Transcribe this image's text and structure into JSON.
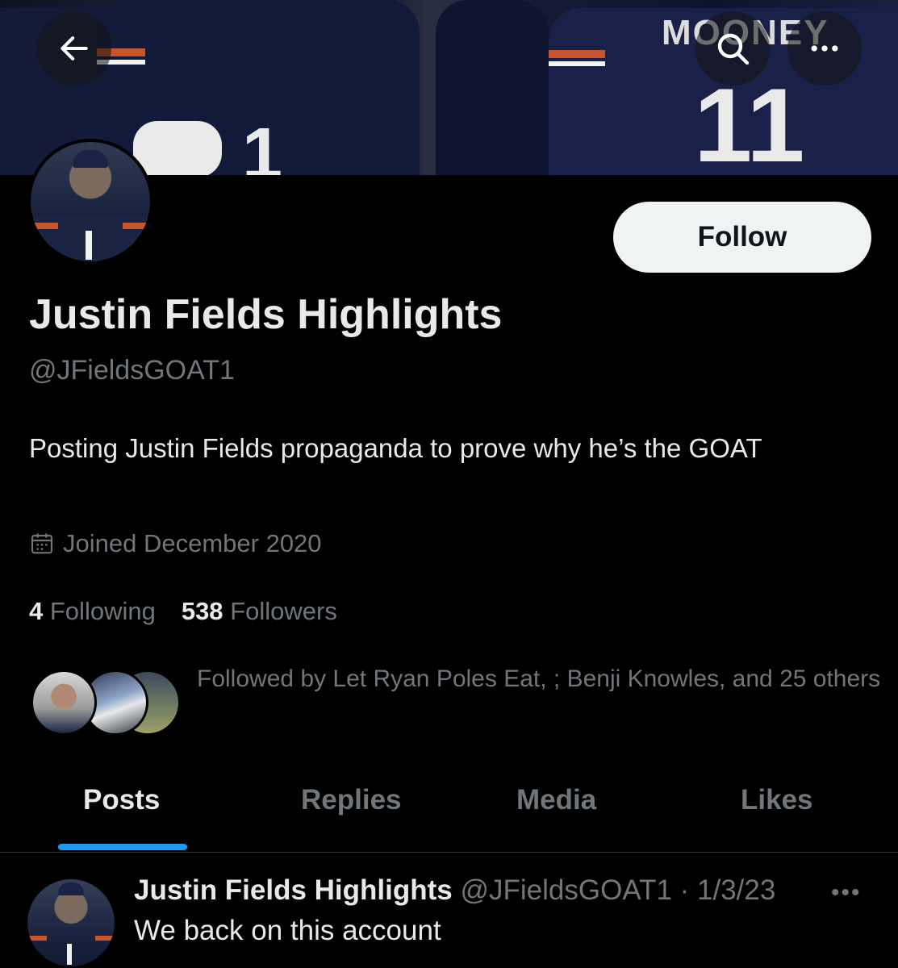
{
  "header": {
    "back_icon": "arrow-left-icon",
    "search_icon": "search-icon",
    "more_icon": "more-horizontal-icon",
    "banner_jersey_text": "MOONEY",
    "banner_numbers": [
      "1",
      "11"
    ]
  },
  "profile": {
    "display_name": "Justin Fields Highlights",
    "handle": "@JFieldsGOAT1",
    "follow_label": "Follow",
    "bio": "Posting Justin Fields propaganda to prove why he’s the GOAT",
    "joined": "Joined December 2020",
    "following_count": "4",
    "following_label": "Following",
    "followers_count": "538",
    "followers_label": "Followers",
    "followed_by": "Followed by Let Ryan Poles Eat, ; Benji Knowles, and 25 others"
  },
  "tabs": [
    {
      "label": "Posts",
      "active": true
    },
    {
      "label": "Replies",
      "active": false
    },
    {
      "label": "Media",
      "active": false
    },
    {
      "label": "Likes",
      "active": false
    }
  ],
  "post": {
    "name": "Justin Fields Highlights",
    "handle": "@JFieldsGOAT1",
    "separator": " · ",
    "date": "1/3/23",
    "text": "We back on this account",
    "more": "•••"
  },
  "colors": {
    "background": "#000000",
    "text_primary": "#e7e9ea",
    "text_secondary": "#71767b",
    "accent": "#1d9bf0",
    "follow_button_bg": "#eff3f4"
  }
}
